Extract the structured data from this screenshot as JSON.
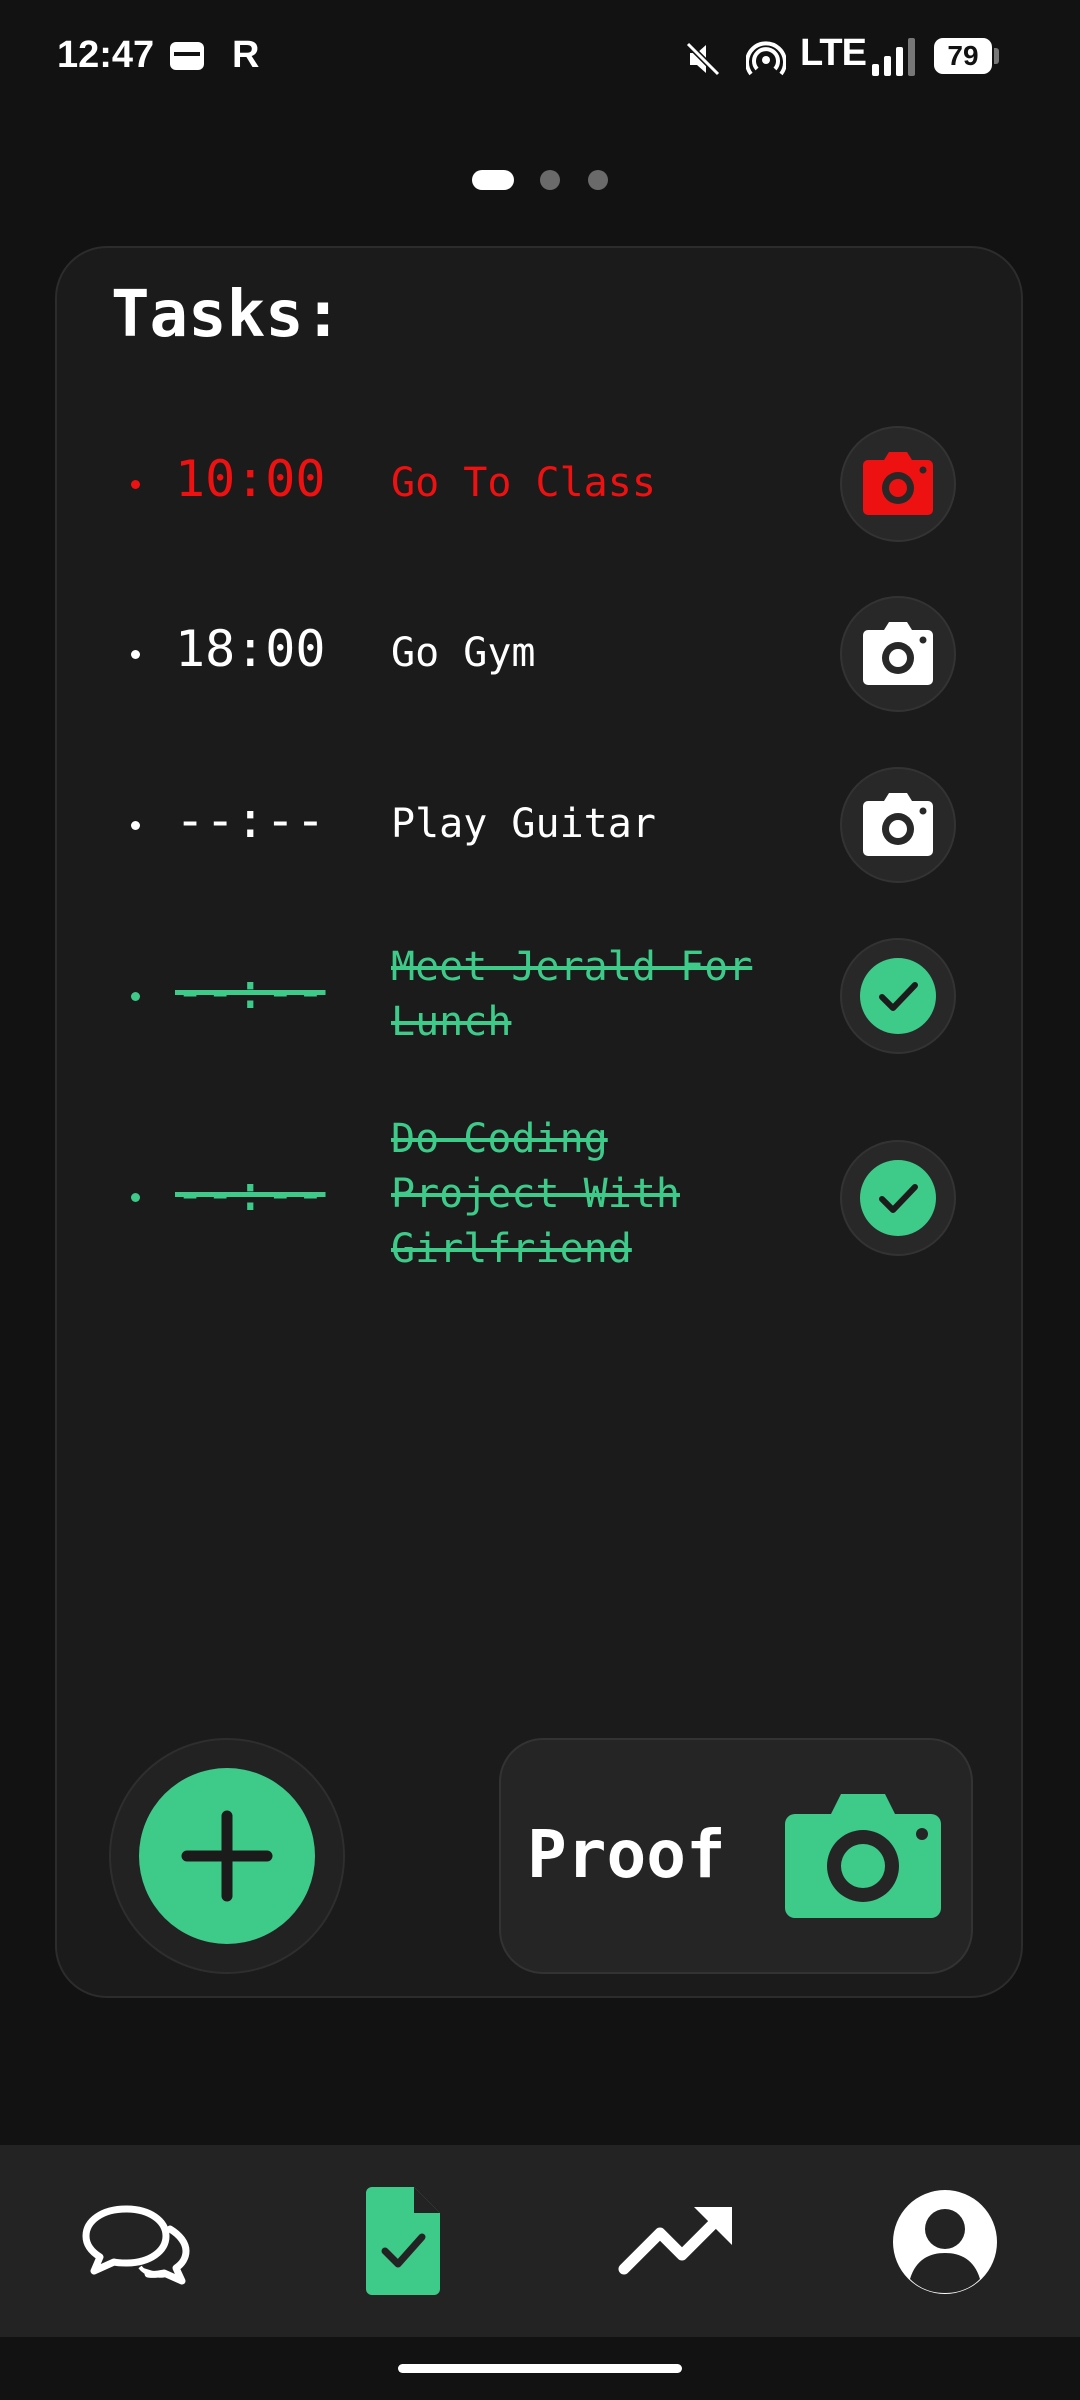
{
  "status_bar": {
    "time": "12:47",
    "network": "LTE",
    "battery": "79"
  },
  "pager": {
    "pages": 3,
    "active_index": 0
  },
  "card": {
    "title": "Tasks:",
    "tasks": [
      {
        "time": "10:00",
        "name": "Go To Class",
        "state": "overdue",
        "icon": "camera-icon",
        "color": "#e11111"
      },
      {
        "time": "18:00",
        "name": "Go Gym",
        "state": "pending",
        "icon": "camera-icon",
        "color": "#ffffff"
      },
      {
        "time": "--:--",
        "name": "Play Guitar",
        "state": "pending",
        "icon": "camera-icon",
        "color": "#ffffff"
      },
      {
        "time": "--:--",
        "name": "Meet Jerald For Lunch",
        "state": "done",
        "icon": "check-icon",
        "color": "#3ecb8a"
      },
      {
        "time": "--:--",
        "name": "Do Coding Project With Girlfriend",
        "state": "done",
        "icon": "check-icon",
        "color": "#3ecb8a"
      }
    ]
  },
  "actions": {
    "add_icon": "plus-icon",
    "proof_label": "Proof",
    "proof_icon": "camera-icon"
  },
  "bottom_nav": [
    {
      "icon": "chat-icon",
      "active": false
    },
    {
      "icon": "task-document-icon",
      "active": true
    },
    {
      "icon": "trending-up-icon",
      "active": false
    },
    {
      "icon": "profile-icon",
      "active": false
    }
  ],
  "colors": {
    "accent": "#3ecb8a",
    "alert": "#e11111",
    "background": "#121212",
    "card": "#1b1b1b"
  }
}
